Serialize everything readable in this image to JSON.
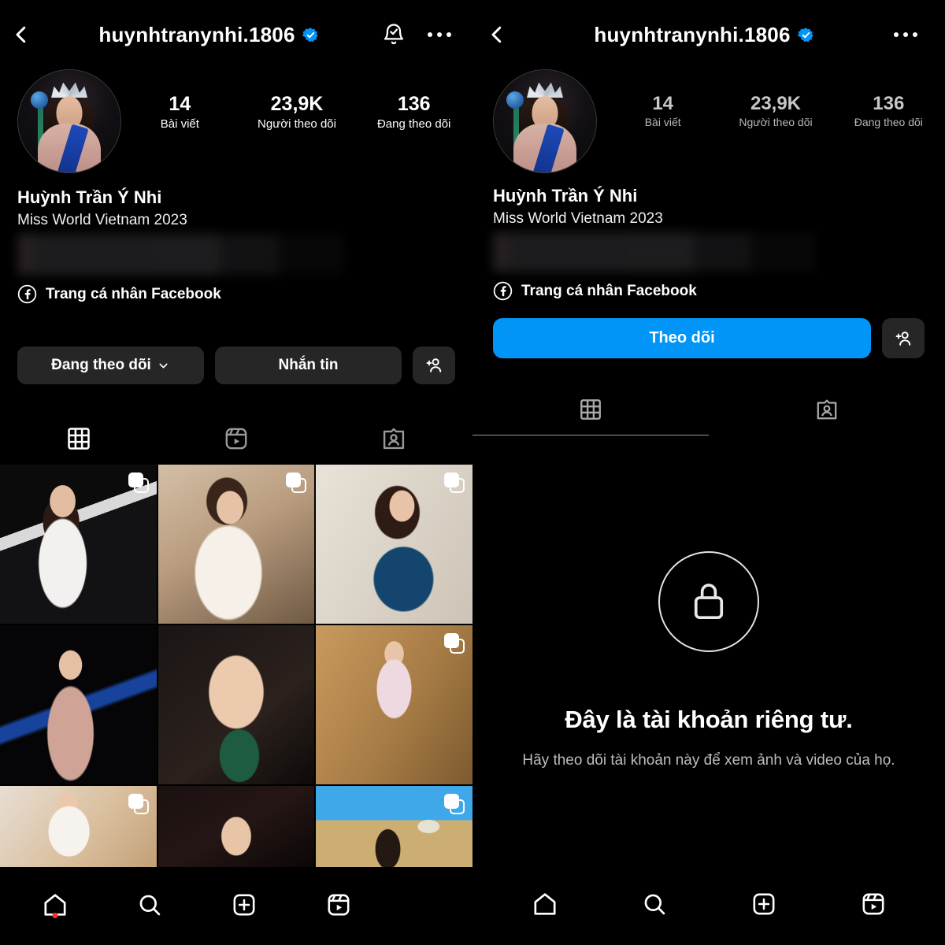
{
  "brand": {
    "accent": "#0095F6",
    "verified_color": "#0095F6",
    "bg": "#000000",
    "button_bg": "#262626",
    "red_dot": "#ff2e2e"
  },
  "left": {
    "header": {
      "back_icon": "chevron-left-icon",
      "username": "huynhtranynhi.1806",
      "verified_icon": "verified-badge-icon",
      "bell_icon": "bell-check-icon",
      "more_icon": "more-options-icon"
    },
    "avatar_alt": "profile-photo",
    "stats": [
      {
        "num": "14",
        "label": "Bài viết"
      },
      {
        "num": "23,9K",
        "label": "Người theo dõi"
      },
      {
        "num": "136",
        "label": "Đang theo dõi"
      }
    ],
    "bio": {
      "fullname": "Huỳnh Trần Ý Nhi",
      "title": "Miss World Vietnam 2023",
      "hidden_line": "",
      "link_icon": "facebook-icon",
      "link_label": "Trang cá nhân Facebook"
    },
    "actions": {
      "following_label": "Đang theo dõi",
      "following_chevron": "chevron-down-icon",
      "message_label": "Nhắn tin",
      "add_person_icon": "add-person-icon"
    },
    "tabs": [
      {
        "icon": "grid-icon",
        "name": "tab-grid",
        "active": true
      },
      {
        "icon": "reels-icon",
        "name": "tab-reels",
        "active": false
      },
      {
        "icon": "tagged-icon",
        "name": "tab-tagged",
        "active": false
      }
    ],
    "grid": [
      {
        "carousel": true,
        "desc": "woman in white dress with crown on dark staircase"
      },
      {
        "carousel": true,
        "desc": "woman in white blouse and sequin dress hand on forehead"
      },
      {
        "carousel": true,
        "desc": "woman with crown in blue feathered gown"
      },
      {
        "carousel": false,
        "desc": "crowned woman with sceptre and blue sash"
      },
      {
        "carousel": false,
        "desc": "close-up portrait smiling in green top"
      },
      {
        "carousel": true,
        "desc": "woman in pink shirt seated at wooden cafe table"
      },
      {
        "carousel": true,
        "desc": "woman in white ruffled top on beige sofa"
      },
      {
        "carousel": false,
        "desc": "woman in dark interior looking aside"
      },
      {
        "carousel": true,
        "desc": "woman outdoors with blue sky and pavilion"
      }
    ],
    "bottom_nav": [
      {
        "icon": "home-icon",
        "name": "nav-home",
        "badge": true
      },
      {
        "icon": "search-icon",
        "name": "nav-search",
        "badge": false
      },
      {
        "icon": "create-icon",
        "name": "nav-create",
        "badge": false
      },
      {
        "icon": "reels-icon",
        "name": "nav-reels",
        "badge": false
      }
    ]
  },
  "right": {
    "header": {
      "back_icon": "chevron-left-icon",
      "username": "huynhtranynhi.1806",
      "verified_icon": "verified-badge-icon",
      "more_icon": "more-options-icon"
    },
    "avatar_alt": "profile-photo",
    "stats": [
      {
        "num": "14",
        "label": "Bài viết"
      },
      {
        "num": "23,9K",
        "label": "Người theo dõi"
      },
      {
        "num": "136",
        "label": "Đang theo dõi"
      }
    ],
    "bio": {
      "fullname": "Huỳnh Trần Ý Nhi",
      "title": "Miss World Vietnam 2023",
      "hidden_line": "",
      "link_icon": "facebook-icon",
      "link_label": "Trang cá nhân Facebook"
    },
    "actions": {
      "follow_label": "Theo dõi",
      "add_person_icon": "add-person-icon"
    },
    "tabs": [
      {
        "icon": "grid-icon",
        "name": "tab-grid",
        "active": true
      },
      {
        "icon": "tagged-icon",
        "name": "tab-tagged",
        "active": false
      }
    ],
    "private": {
      "lock_icon": "lock-icon",
      "title": "Đây là tài khoản riêng tư.",
      "subtitle": "Hãy theo dõi tài khoản này để xem ảnh và video của họ."
    },
    "bottom_nav": [
      {
        "icon": "home-icon",
        "name": "nav-home",
        "badge": false
      },
      {
        "icon": "search-icon",
        "name": "nav-search",
        "badge": false
      },
      {
        "icon": "create-icon",
        "name": "nav-create",
        "badge": false
      },
      {
        "icon": "reels-icon",
        "name": "nav-reels",
        "badge": false
      }
    ]
  }
}
